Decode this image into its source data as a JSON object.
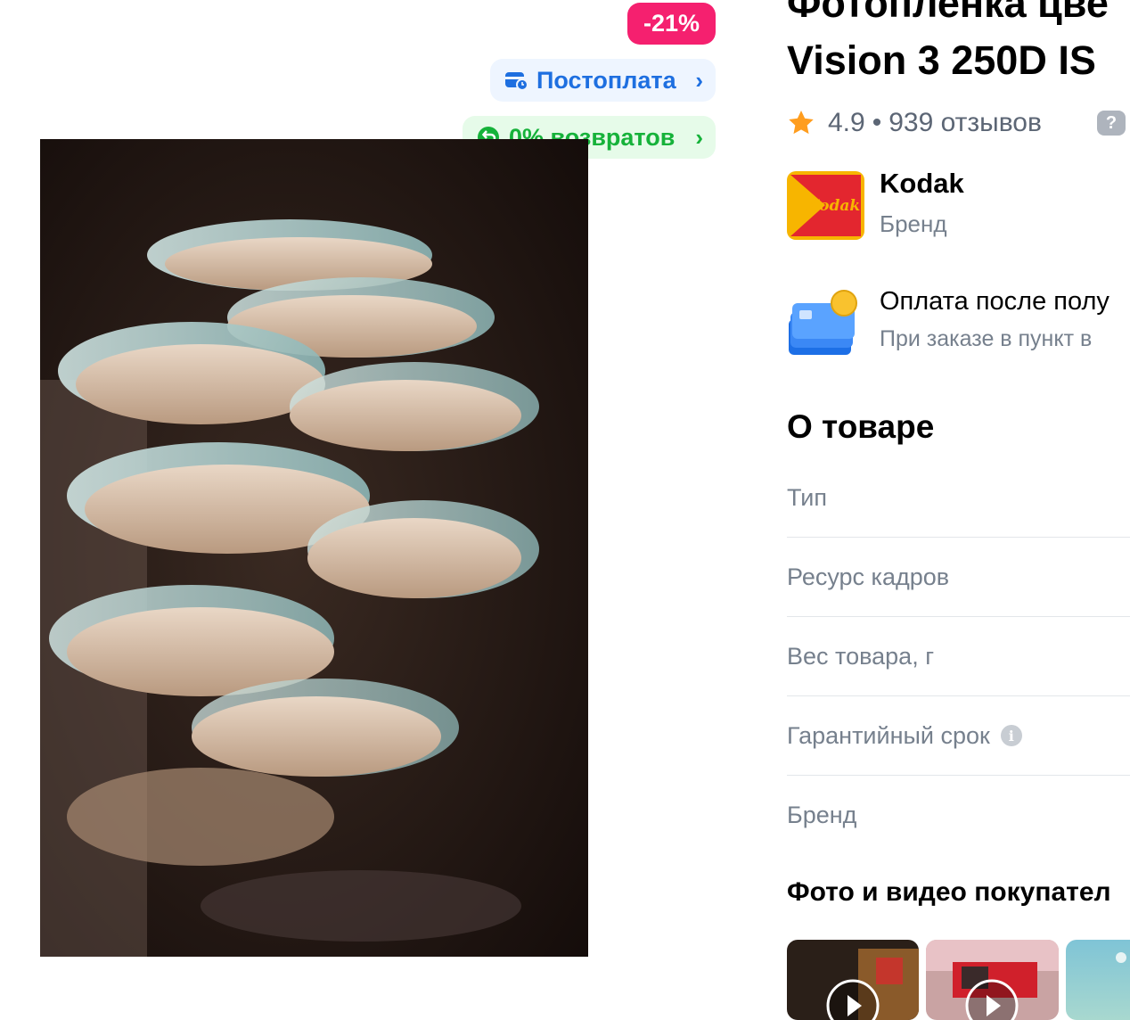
{
  "badges": {
    "discount": "-21%",
    "postpay": "Постоплата",
    "returns": "0% возвратов"
  },
  "product": {
    "title_line1": "Фотопленка цве",
    "title_line2": "Vision 3 250D IS",
    "rating": "4.9",
    "reviews": "939 отзывов",
    "help": "?"
  },
  "brand": {
    "logo_text": "Kodak",
    "name": "Kodak",
    "role": "Бренд"
  },
  "payment": {
    "title": "Оплата после полу",
    "subtitle": "При заказе в пункт в"
  },
  "about": {
    "heading": "О товаре",
    "specs": [
      "Тип",
      "Ресурс кадров",
      "Вес товара, г",
      "Гарантийный срок",
      "Бренд"
    ]
  },
  "media": {
    "heading": "Фото и видео покупател"
  },
  "colors": {
    "discount": "#f5206f",
    "postpay": "#1e6fe0",
    "returns": "#16b23a",
    "star": "#ff9d1e"
  },
  "icons": [
    "wallet-clock-icon",
    "return-icon",
    "chevron-right-icon",
    "star-icon",
    "question-icon",
    "info-icon",
    "payment-cards-icon",
    "play-icon"
  ]
}
